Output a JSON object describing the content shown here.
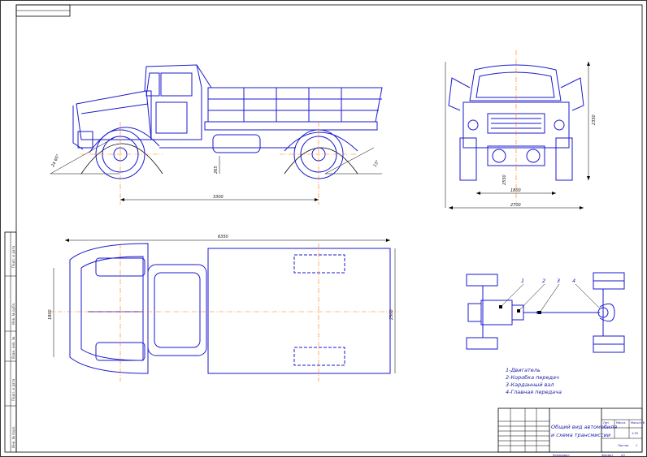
{
  "dimensions": {
    "wheelbase": "3300",
    "overall_length": "6350",
    "overall_width": "2500",
    "front_track": "1800",
    "height": "2350",
    "ground_clearance": "2550",
    "cab_width": "1800",
    "rear_track": "2700",
    "approach_angle": "24 65°",
    "departure_angle": "15°",
    "clearance_front": "265",
    "body_width": "1800"
  },
  "legend": {
    "items": [
      "1-Двигатель",
      "2-Коробка передач",
      "3-Карданный вал",
      "4-Главная передача"
    ],
    "markers": [
      "1",
      "2",
      "3",
      "4"
    ]
  },
  "title_block": {
    "title_line1": "Общий вид автомобиля",
    "title_line2": "и схема трансмиссии",
    "sheet_label": "Листов",
    "sheet_count": "1",
    "stage": "Лит.",
    "mass": "Масса",
    "scale": "Масштаб",
    "scale_value": "1:50",
    "copied": "Копировал",
    "format": "Формат",
    "format_value": "A3"
  },
  "side_strip": [
    "Подп. и дата",
    "Инв. № дубл.",
    "Взам. инв. №",
    "Подп. и дата",
    "Инв. № подл."
  ]
}
